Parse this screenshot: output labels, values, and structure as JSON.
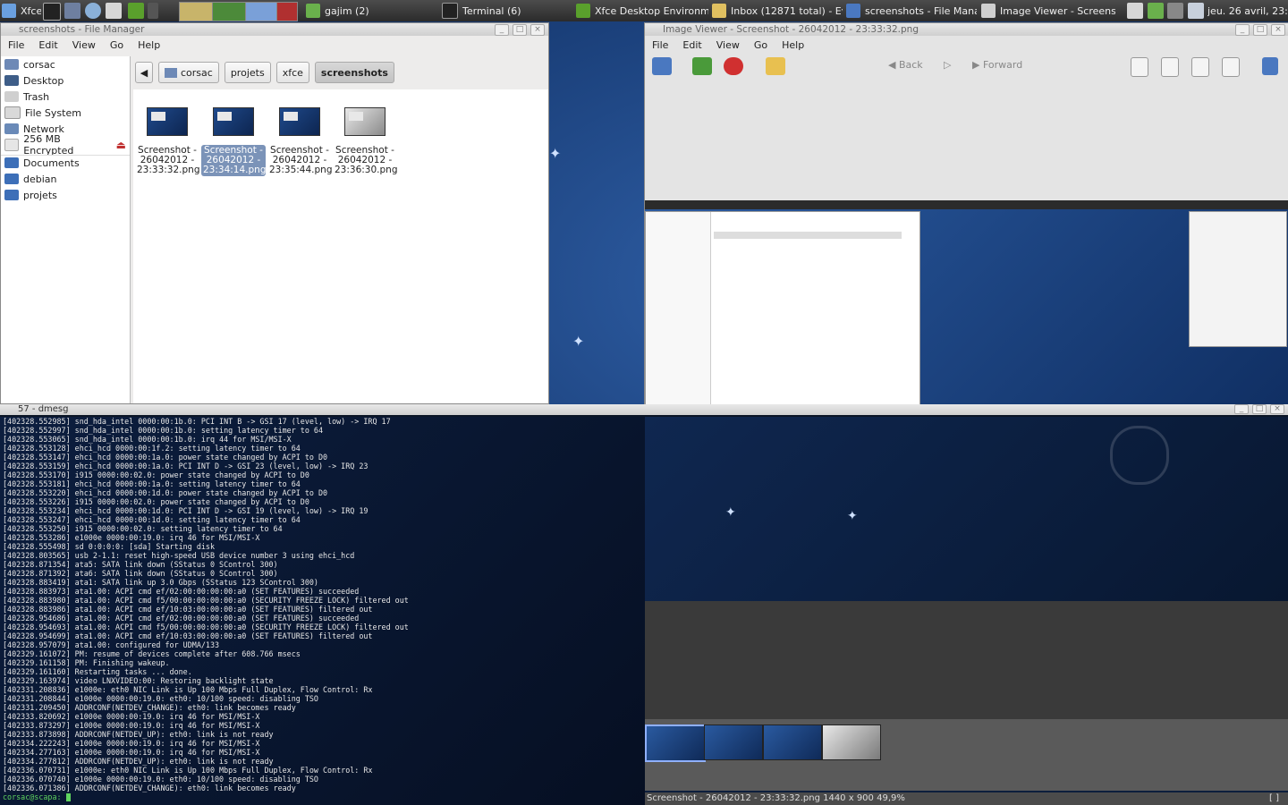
{
  "panel": {
    "menu_label": "Xfce",
    "tasks": [
      {
        "label": "gajim (2)"
      },
      {
        "label": "Terminal (6)"
      },
      {
        "label": "Xfce Desktop Environm..."
      },
      {
        "label": "Inbox (12871 total) - Ev..."
      },
      {
        "label": "screenshots - File Mana..."
      },
      {
        "label": "Image Viewer - Screens..."
      }
    ],
    "clock": "jeu. 26 avril, 23:"
  },
  "file_manager": {
    "title": "screenshots - File Manager",
    "menu": [
      "File",
      "Edit",
      "View",
      "Go",
      "Help"
    ],
    "sidebar": [
      {
        "label": "corsac"
      },
      {
        "label": "Desktop"
      },
      {
        "label": "Trash"
      },
      {
        "label": "File System"
      },
      {
        "label": "Network"
      },
      {
        "label": "256 MB Encrypted"
      },
      {
        "label": "Documents"
      },
      {
        "label": "debian"
      },
      {
        "label": "projets"
      }
    ],
    "path": [
      "corsac",
      "projets",
      "xfce",
      "screenshots"
    ],
    "files": [
      {
        "name": "Screenshot -\n26042012 -\n23:33:32.png"
      },
      {
        "name": "Screenshot -\n26042012 -\n23:34:14.png"
      },
      {
        "name": "Screenshot -\n26042012 -\n23:35:44.png"
      },
      {
        "name": "Screenshot -\n26042012 -\n23:36:30.png"
      }
    ]
  },
  "image_viewer": {
    "title": "Image Viewer - Screenshot - 26042012 - 23:33:32.png",
    "menu": [
      "File",
      "Edit",
      "View",
      "Go",
      "Help"
    ],
    "back_label": "Back",
    "forward_label": "Forward",
    "status": "Screenshot - 26042012 - 23:33:32.png   1440 x 900     49,9%",
    "status_right": "[ ]"
  },
  "terminal": {
    "title": "57 - dmesg",
    "lines": [
      "[402328.552985] snd_hda_intel 0000:00:1b.0: PCI INT B -> GSI 17 (level, low) -> IRQ 17",
      "[402328.552997] snd_hda_intel 0000:00:1b.0: setting latency timer to 64",
      "[402328.553065] snd_hda_intel 0000:00:1b.0: irq 44 for MSI/MSI-X",
      "[402328.553128] ehci_hcd 0000:00:1f.2: setting latency timer to 64",
      "[402328.553147] ehci_hcd 0000:00:1a.0: power state changed by ACPI to D0",
      "[402328.553159] ehci_hcd 0000:00:1a.0: PCI INT D -> GSI 23 (level, low) -> IRQ 23",
      "[402328.553170] i915 0000:00:02.0: power state changed by ACPI to D0",
      "[402328.553181] ehci_hcd 0000:00:1a.0: setting latency timer to 64",
      "[402328.553220] ehci_hcd 0000:00:1d.0: power state changed by ACPI to D0",
      "[402328.553226] i915 0000:00:02.0: power state changed by ACPI to D0",
      "[402328.553234] ehci_hcd 0000:00:1d.0: PCI INT D -> GSI 19 (level, low) -> IRQ 19",
      "[402328.553247] ehci_hcd 0000:00:1d.0: setting latency timer to 64",
      "[402328.553250] i915 0000:00:02.0: setting latency timer to 64",
      "[402328.553286] e1000e 0000:00:19.0: irq 46 for MSI/MSI-X",
      "[402328.555498] sd 0:0:0:0: [sda] Starting disk",
      "[402328.803565] usb 2-1.1: reset high-speed USB device number 3 using ehci_hcd",
      "[402328.871354] ata5: SATA link down (SStatus 0 SControl 300)",
      "[402328.871392] ata6: SATA link down (SStatus 0 SControl 300)",
      "[402328.883419] ata1: SATA link up 3.0 Gbps (SStatus 123 SControl 300)",
      "[402328.883973] ata1.00: ACPI cmd ef/02:00:00:00:00:a0 (SET FEATURES) succeeded",
      "[402328.883980] ata1.00: ACPI cmd f5/00:00:00:00:00:a0 (SECURITY FREEZE LOCK) filtered out",
      "[402328.883986] ata1.00: ACPI cmd ef/10:03:00:00:00:a0 (SET FEATURES) filtered out",
      "[402328.954686] ata1.00: ACPI cmd ef/02:00:00:00:00:a0 (SET FEATURES) succeeded",
      "[402328.954693] ata1.00: ACPI cmd f5/00:00:00:00:00:a0 (SECURITY FREEZE LOCK) filtered out",
      "[402328.954699] ata1.00: ACPI cmd ef/10:03:00:00:00:a0 (SET FEATURES) filtered out",
      "[402328.957079] ata1.00: configured for UDMA/133",
      "[402329.161072] PM: resume of devices complete after 608.766 msecs",
      "[402329.161158] PM: Finishing wakeup.",
      "[402329.161160] Restarting tasks ... done.",
      "[402329.163974] video LNXVIDEO:00: Restoring backlight state",
      "[402331.208836] e1000e: eth0 NIC Link is Up 100 Mbps Full Duplex, Flow Control: Rx",
      "[402331.208844] e1000e 0000:00:19.0: eth0: 10/100 speed: disabling TSO",
      "[402331.209450] ADDRCONF(NETDEV_CHANGE): eth0: link becomes ready",
      "[402333.820692] e1000e 0000:00:19.0: irq 46 for MSI/MSI-X",
      "[402333.873297] e1000e 0000:00:19.0: irq 46 for MSI/MSI-X",
      "[402333.873898] ADDRCONF(NETDEV_UP): eth0: link is not ready",
      "[402334.222243] e1000e 0000:00:19.0: irq 46 for MSI/MSI-X",
      "[402334.277163] e1000e 0000:00:19.0: irq 46 for MSI/MSI-X",
      "[402334.277812] ADDRCONF(NETDEV_UP): eth0: link is not ready",
      "[402336.070731] e1000e: eth0 NIC Link is Up 100 Mbps Full Duplex, Flow Control: Rx",
      "[402336.070740] e1000e 0000:00:19.0: eth0: 10/100 speed: disabling TSO",
      "[402336.071386] ADDRCONF(NETDEV_CHANGE): eth0: link becomes ready"
    ],
    "prompt": "corsac@scapa:"
  },
  "colors": {
    "selection": "#7b93b8",
    "terminal_bg": "#0b1526",
    "prompt": "#5fd35f",
    "folder": "#3d6fb8"
  },
  "icons": {
    "panel_menu": "xfce-mouse-icon",
    "eject": "eject-icon",
    "stop": "stop-icon",
    "edit": "pencil-icon"
  }
}
